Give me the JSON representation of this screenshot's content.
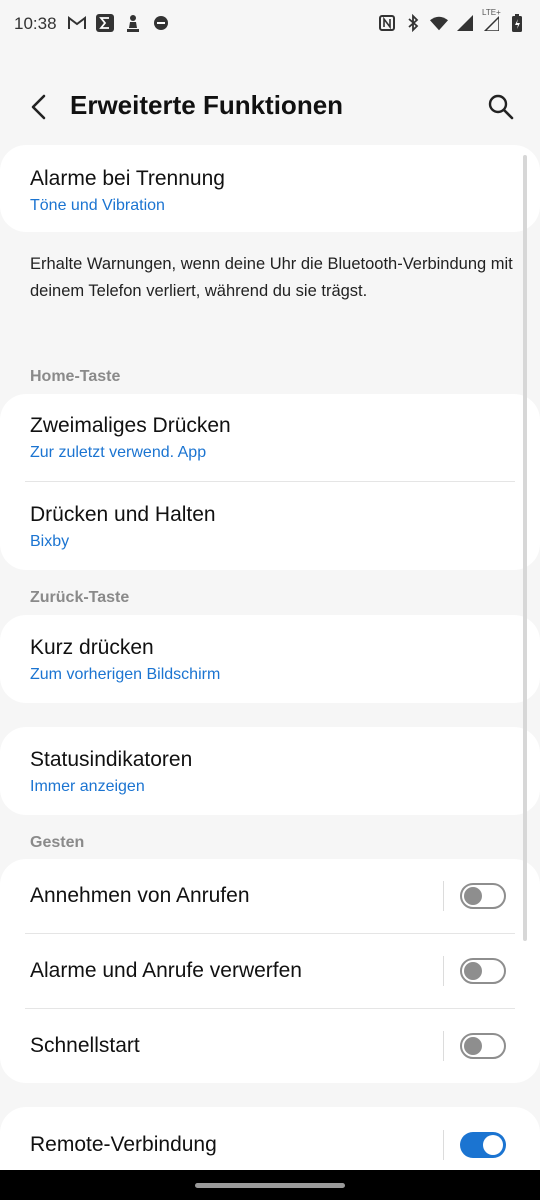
{
  "status_bar": {
    "time": "10:38",
    "left_icons": [
      "gmail-icon",
      "sigma-app-icon",
      "chess-pawn-icon",
      "dnd-icon"
    ],
    "right_icons": [
      "nfc-icon",
      "bluetooth-icon",
      "wifi-icon",
      "signal-icon",
      "signal-lte-icon",
      "battery-icon"
    ],
    "lte_label": "LTE+"
  },
  "header": {
    "title": "Erweiterte Funktionen"
  },
  "alarms": {
    "title": "Alarme bei Trennung",
    "subtitle": "Töne und Vibration",
    "description": "Erhalte Warnungen, wenn deine Uhr die Bluetooth-Verbindung mit deinem Telefon verliert, während du sie trägst."
  },
  "home_key": {
    "section_label": "Home-Taste",
    "items": [
      {
        "title": "Zweimaliges Drücken",
        "subtitle": "Zur zuletzt verwend. App"
      },
      {
        "title": "Drücken und Halten",
        "subtitle": "Bixby"
      }
    ]
  },
  "back_key": {
    "section_label": "Zurück-Taste",
    "items": [
      {
        "title": "Kurz drücken",
        "subtitle": "Zum vorherigen Bildschirm"
      }
    ]
  },
  "status": {
    "title": "Statusindikatoren",
    "subtitle": "Immer anzeigen"
  },
  "gestures": {
    "section_label": "Gesten",
    "items": [
      {
        "title": "Annehmen von Anrufen",
        "enabled": false
      },
      {
        "title": "Alarme und Anrufe verwerfen",
        "enabled": false
      },
      {
        "title": "Schnellstart",
        "enabled": false
      }
    ]
  },
  "remote": {
    "title": "Remote-Verbindung",
    "enabled": true
  },
  "colors": {
    "accent": "#1b74d1",
    "background": "#f6f6f6",
    "card": "#ffffff"
  }
}
